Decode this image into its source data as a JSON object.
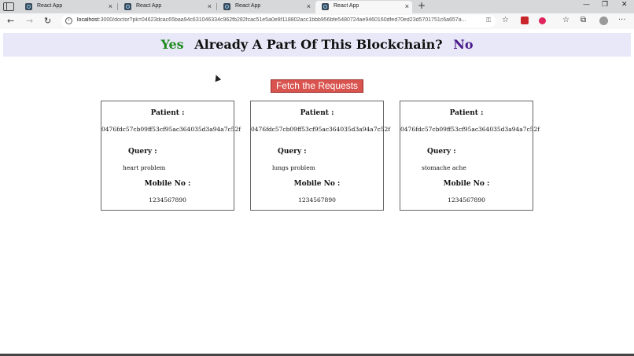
{
  "browser": {
    "tabs": [
      {
        "title": "React App",
        "close": "×"
      },
      {
        "title": "React App",
        "close": "×"
      },
      {
        "title": "React App",
        "close": "×"
      },
      {
        "title": "React App",
        "close": "×"
      }
    ],
    "active_tab": 3,
    "new_tab": "+",
    "window": {
      "minimize": "—",
      "maximize": "❐",
      "close": "✕"
    },
    "nav": {
      "back": "←",
      "forward": "→",
      "refresh": "↻"
    },
    "url_host": "localhost",
    "url_rest": ":3000/doctor?pk=04623dcac65baa94c631046334c962fb282fcac51e5a0e8f118802acc1bbb956bfe5480724ae9460160dfed70ed23d5701751c6a657a...",
    "icons": {
      "info": "i",
      "key": "⚿",
      "favorite": "☆",
      "favorites": "☆",
      "collections": "⧉",
      "more": "···"
    }
  },
  "banner": {
    "yes": "Yes",
    "question": "Already A Part Of This Blockchain?",
    "no": "No"
  },
  "fetch_button": "Fetch the Requests",
  "requests": [
    {
      "patient_label": "Patient :",
      "patient": "0476fdc57cb09ff53cf95ac364035d3a94a7c52f",
      "query_label": "Query :",
      "query": "heart problem",
      "mobile_label": "Mobile No :",
      "mobile": "1234567890"
    },
    {
      "patient_label": "Patient :",
      "patient": "0476fdc57cb09ff53cf95ac364035d3a94a7c52f",
      "query_label": "Query :",
      "query": "lungs problem",
      "mobile_label": "Mobile No :",
      "mobile": "1234567890"
    },
    {
      "patient_label": "Patient :",
      "patient": "0476fdc57cb09ff53cf95ac364035d3a94a7c52f",
      "query_label": "Query :",
      "query": "stomache ache",
      "mobile_label": "Mobile No :",
      "mobile": "1234567890"
    }
  ],
  "colors": {
    "banner_bg": "#e8e8f8",
    "yes": "#1f8a1f",
    "no": "#4a1a8a",
    "button": "#d9534f"
  }
}
